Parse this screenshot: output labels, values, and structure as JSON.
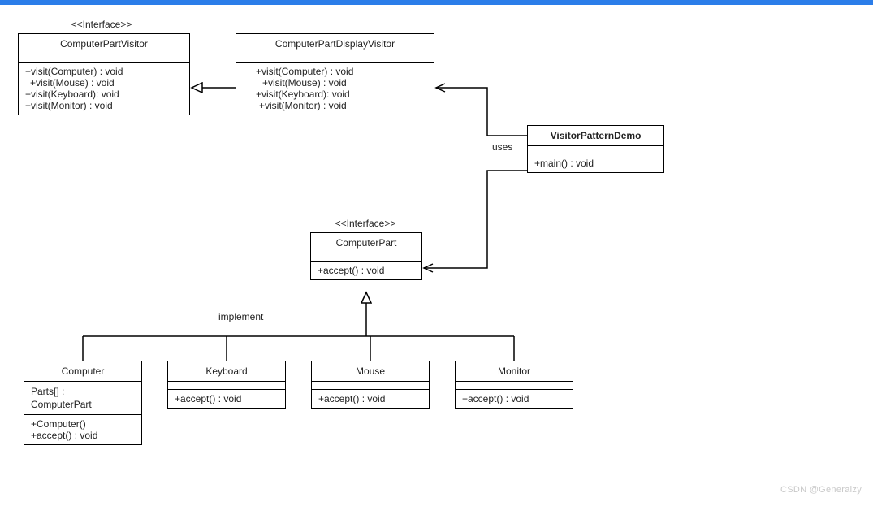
{
  "topbar_color": "#2b7de9",
  "labels": {
    "interface_stereotype": "<<Interface>>",
    "uses": "uses",
    "implement": "implement"
  },
  "classes": {
    "visitor_if": {
      "name": "ComputerPartVisitor",
      "methods": [
        "+visit(Computer)  : void",
        "+visit(Mouse)  : void",
        "+visit(Keyboard):  void",
        "+visit(Monitor)  : void"
      ]
    },
    "display_visitor": {
      "name": "ComputerPartDisplayVisitor",
      "methods": [
        "+visit(Computer)  : void",
        "+visit(Mouse)  : void",
        "+visit(Keyboard):  void",
        "+visit(Monitor)  : void"
      ]
    },
    "demo": {
      "name": "VisitorPatternDemo",
      "methods": [
        "+main() : void"
      ]
    },
    "part_if": {
      "name": "ComputerPart",
      "methods": [
        "+accept() : void"
      ]
    },
    "computer": {
      "name": "Computer",
      "attrs": [
        "Parts[] : ComputerPart"
      ],
      "methods": [
        "+Computer()",
        "+accept() : void"
      ]
    },
    "keyboard": {
      "name": "Keyboard",
      "methods": [
        "+accept() : void"
      ]
    },
    "mouse": {
      "name": "Mouse",
      "methods": [
        "+accept() : void"
      ]
    },
    "monitor": {
      "name": "Monitor",
      "methods": [
        "+accept() : void"
      ]
    }
  },
  "watermark": "CSDN @Generalzy"
}
